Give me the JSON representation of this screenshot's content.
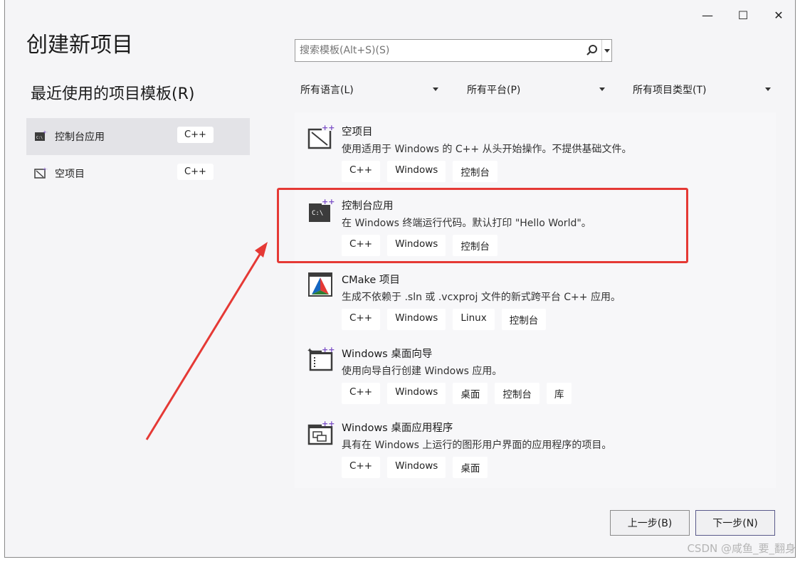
{
  "header": {
    "title": "创建新项目",
    "minimize": "—",
    "maximize": "☐",
    "close": "✕"
  },
  "recent": {
    "title": "最近使用的项目模板(R)",
    "items": [
      {
        "label": "控制台应用",
        "tag": "C++",
        "icon": "console-app-icon",
        "selected": true
      },
      {
        "label": "空项目",
        "tag": "C++",
        "icon": "empty-project-icon",
        "selected": false
      }
    ]
  },
  "search": {
    "placeholder": "搜索模板(Alt+S)(S)"
  },
  "filters": [
    {
      "label": "所有语言(L)"
    },
    {
      "label": "所有平台(P)"
    },
    {
      "label": "所有项目类型(T)"
    }
  ],
  "templates": [
    {
      "name": "空项目",
      "desc": "使用适用于 Windows 的 C++ 从头开始操作。不提供基础文件。",
      "tags": [
        "C++",
        "Windows",
        "控制台"
      ],
      "icon": "empty-project-icon"
    },
    {
      "name": "控制台应用",
      "desc": "在 Windows 终端运行代码。默认打印 \"Hello World\"。",
      "tags": [
        "C++",
        "Windows",
        "控制台"
      ],
      "icon": "console-app-icon"
    },
    {
      "name": "CMake 项目",
      "desc": "生成不依赖于 .sln 或 .vcxproj 文件的新式跨平台 C++ 应用。",
      "tags": [
        "C++",
        "Windows",
        "Linux",
        "控制台"
      ],
      "icon": "cmake-icon"
    },
    {
      "name": "Windows 桌面向导",
      "desc": "使用向导自行创建 Windows 应用。",
      "tags": [
        "C++",
        "Windows",
        "桌面",
        "控制台",
        "库"
      ],
      "icon": "wizard-icon"
    },
    {
      "name": "Windows 桌面应用程序",
      "desc": "具有在 Windows 上运行的图形用户界面的应用程序的项目。",
      "tags": [
        "C++",
        "Windows",
        "桌面"
      ],
      "icon": "desktop-app-icon"
    }
  ],
  "buttons": {
    "back": "上一步(B)",
    "next": "下一步(N)"
  },
  "watermark": "CSDN @咸鱼_要_翻身",
  "colors": {
    "highlight": "#e53935",
    "accent": "#7b4fc6"
  }
}
